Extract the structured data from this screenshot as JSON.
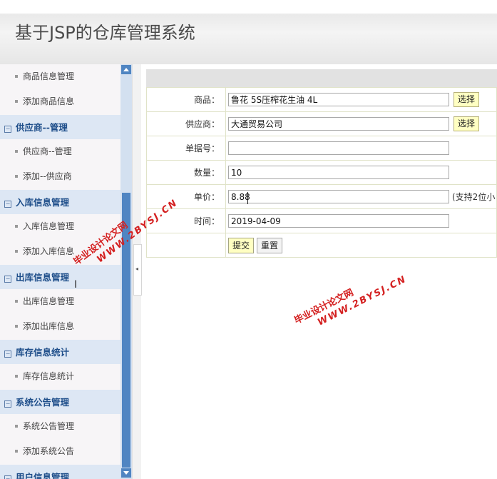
{
  "header": {
    "title": "基于JSP的仓库管理系统"
  },
  "sidebar": {
    "groups": [
      {
        "label": "",
        "items": [
          "商品信息管理",
          "添加商品信息"
        ]
      },
      {
        "label": "供应商--管理",
        "items": [
          "供应商--管理",
          "添加--供应商"
        ]
      },
      {
        "label": "入库信息管理",
        "items": [
          "入库信息管理",
          "添加入库信息"
        ]
      },
      {
        "label": "出库信息管理",
        "items": [
          "出库信息管理",
          "添加出库信息"
        ]
      },
      {
        "label": "库存信息统计",
        "items": [
          "库存信息统计"
        ]
      },
      {
        "label": "系统公告管理",
        "items": [
          "系统公告管理",
          "添加系统公告"
        ]
      },
      {
        "label": "用户信息管理",
        "items": []
      }
    ],
    "expand_symbol": "⊟"
  },
  "form": {
    "product": {
      "label": "商品：",
      "value": "鲁花 5S压榨花生油 4L",
      "button": "选择"
    },
    "supplier": {
      "label": "供应商：",
      "value": "大通贸易公司",
      "button": "选择"
    },
    "doc_no": {
      "label": "单据号：",
      "value": ""
    },
    "quantity": {
      "label": "数量：",
      "value": "10"
    },
    "price": {
      "label": "单价：",
      "value": "8.88",
      "hint": "(支持2位小"
    },
    "time": {
      "label": "时间：",
      "value": "2019-04-09"
    },
    "submit": "提交",
    "reset": "重置"
  },
  "watermark": {
    "line1": "毕业设计论文网",
    "line2": "WWW.2BYSJ.CN"
  },
  "splitter": {
    "arrow": "◂"
  },
  "colors": {
    "group_bg": "#dde7f4",
    "group_text": "#1e4e8a",
    "scrollbar": "#4f85c2",
    "select_button": "#ffffc2",
    "watermark": "#d42020"
  }
}
